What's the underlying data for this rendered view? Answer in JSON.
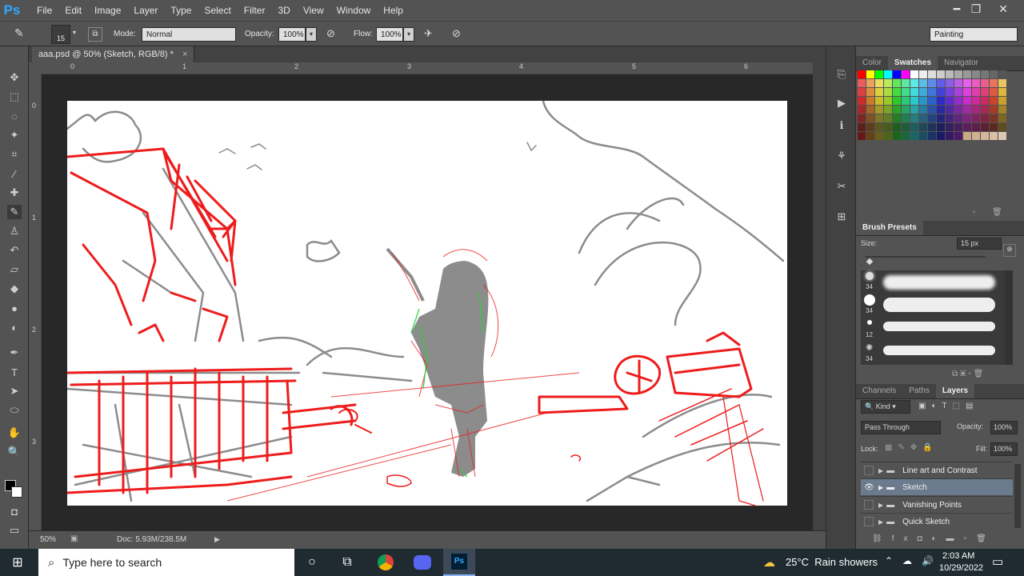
{
  "menubar": {
    "logo": "Ps",
    "items": [
      "File",
      "Edit",
      "Image",
      "Layer",
      "Type",
      "Select",
      "Filter",
      "3D",
      "View",
      "Window",
      "Help"
    ]
  },
  "window_controls": {
    "minimize": "━",
    "restore": "❐",
    "close": "✕"
  },
  "options": {
    "brush_size": "15",
    "mode_label": "Mode:",
    "mode_value": "Normal",
    "opacity_label": "Opacity:",
    "opacity_value": "100%",
    "flow_label": "Flow:",
    "flow_value": "100%",
    "workspace": "Painting"
  },
  "document": {
    "tab_title": "aaa.psd @ 50% (Sketch, RGB/8) *",
    "tab_close": "×",
    "ruler_top": [
      "0",
      "1",
      "2",
      "3",
      "4",
      "5",
      "6"
    ],
    "ruler_left": [
      "0",
      "1",
      "2",
      "3"
    ]
  },
  "status": {
    "zoom": "50%",
    "doc": "Doc: 5.93M/238.5M"
  },
  "swatches_panel": {
    "tabs": [
      "Color",
      "Swatches",
      "Navigator"
    ],
    "active": "Swatches"
  },
  "brush_panel": {
    "title": "Brush Presets",
    "size_label": "Size:",
    "size_value": "15 px",
    "presets": [
      "34",
      "34",
      "12",
      "34"
    ]
  },
  "layers_panel": {
    "tabs": [
      "Channels",
      "Paths",
      "Layers"
    ],
    "active": "Layers",
    "kind": "Kind",
    "blend_mode": "Pass Through",
    "opacity_label": "Opacity:",
    "opacity_value": "100%",
    "lock_label": "Lock:",
    "fill_label": "Fill:",
    "fill_value": "100%",
    "layers": [
      {
        "name": "Line art and Contrast",
        "visible": false,
        "selected": false
      },
      {
        "name": "Sketch",
        "visible": true,
        "selected": true
      },
      {
        "name": "Vanishing Points",
        "visible": false,
        "selected": false
      },
      {
        "name": "Quick Sketch",
        "visible": false,
        "selected": false
      }
    ]
  },
  "taskbar": {
    "search_placeholder": "Type here to search",
    "weather": "25°C  Rain showers",
    "time": "2:03 AM",
    "date": "10/29/2022"
  },
  "colors": {
    "accent_red": "#ee1c1c",
    "sketch_gray": "#8c8c8c",
    "ps_blue": "#31a8ff",
    "layer_selected": "#6c7a8d"
  }
}
